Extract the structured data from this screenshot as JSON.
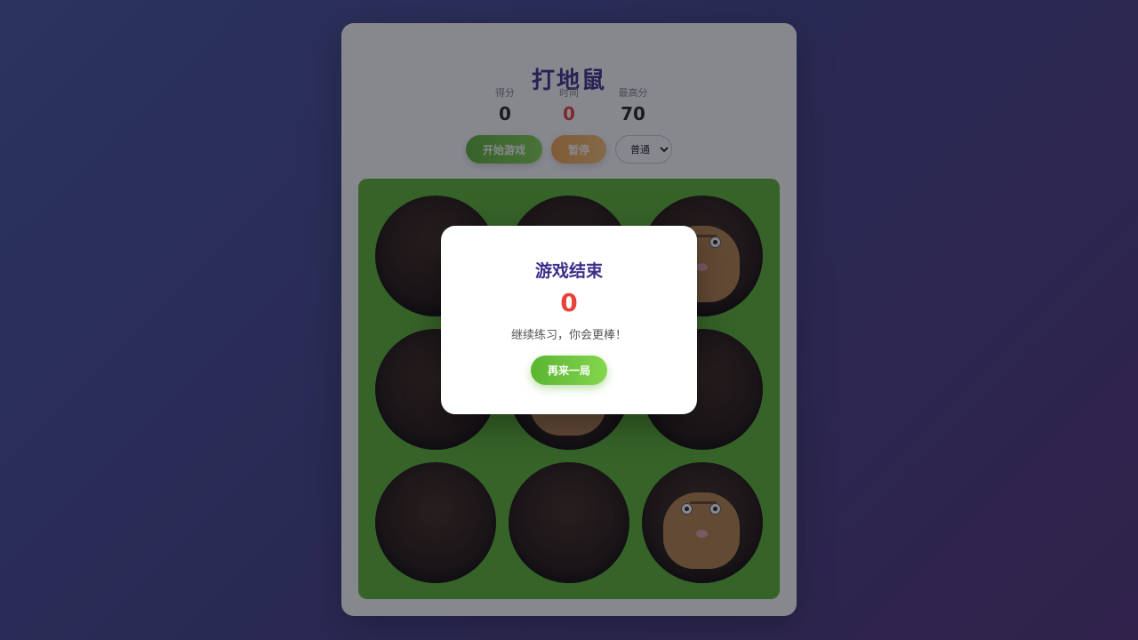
{
  "game": {
    "title": "打地鼠",
    "stats": [
      {
        "label": "得分",
        "value": "0"
      },
      {
        "label": "时间",
        "value": "0"
      },
      {
        "label": "最高分",
        "value": "70"
      }
    ],
    "start_label": "开始游戏",
    "pause_label": "暂停",
    "difficulty_selected": "普通"
  },
  "holes": [
    {
      "mole": false
    },
    {
      "mole": false
    },
    {
      "mole": true
    },
    {
      "mole": false
    },
    {
      "mole": true
    },
    {
      "mole": false
    },
    {
      "mole": false
    },
    {
      "mole": false
    },
    {
      "mole": true
    }
  ],
  "modal": {
    "title": "游戏结束",
    "score": "0",
    "message": "继续练习，你会更棒！",
    "again_label": "再来一局"
  },
  "colors": {
    "accent": "#3b2e8a",
    "score_red": "#e8433a",
    "grass": "#5ab72f",
    "start_green": "#5bb531",
    "pause_orange": "#f3a54a"
  }
}
